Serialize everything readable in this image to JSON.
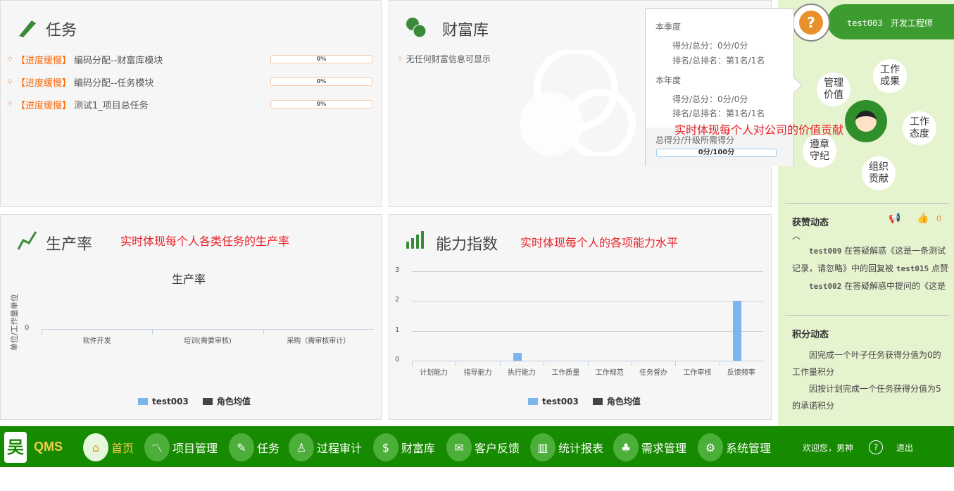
{
  "tasks": {
    "title": "任务",
    "items": [
      {
        "status": "【进度缓慢】",
        "name": "编码分配--财富库模块",
        "progress": "0%"
      },
      {
        "status": "【进度缓慢】",
        "name": "编码分配--任务模块",
        "progress": "0%"
      },
      {
        "status": "【进度缓慢】",
        "name": "测试1_项目总任务",
        "progress": "0%"
      }
    ]
  },
  "wealth": {
    "title": "财富库",
    "empty": "无任何财富信息可显示"
  },
  "productivity": {
    "title": "生产率",
    "annotation": "实时体现每个人各类任务的生产率"
  },
  "ability": {
    "title": "能力指数",
    "annotation": "实时体现每个人的各项能力水平"
  },
  "chart_data": [
    {
      "type": "bar",
      "title": "生产率",
      "ylabel": "单位/工作量单位",
      "categories": [
        "软件开发",
        "培训(需要审核)",
        "采购（需审核审计）"
      ],
      "yticks": [
        "0"
      ],
      "series": [
        {
          "name": "test003",
          "color": "#7cb5ec",
          "values": [
            0,
            0,
            0
          ]
        },
        {
          "name": "角色均值",
          "color": "#434348",
          "values": [
            0,
            0,
            0
          ]
        }
      ]
    },
    {
      "type": "bar",
      "title": "",
      "ylim": [
        0,
        3
      ],
      "yticks": [
        "0",
        "1",
        "2",
        "3"
      ],
      "categories": [
        "计划能力",
        "指导能力",
        "执行能力",
        "工作质量",
        "工作规范",
        "任务督办",
        "工作审核",
        "反馈频率"
      ],
      "series": [
        {
          "name": "test003",
          "color": "#7cb5ec",
          "values": [
            0,
            0,
            0.25,
            0,
            0,
            0,
            0,
            2
          ]
        },
        {
          "name": "角色均值",
          "color": "#434348",
          "values": [
            0,
            0,
            0,
            0,
            0,
            0,
            0,
            0
          ]
        }
      ]
    }
  ],
  "popup": {
    "quarter": "本季度",
    "q_score": "得分/总分：0分/0分",
    "q_rank": "排名/总排名：第1名/1名",
    "year": "本年度",
    "y_score": "得分/总分：0分/0分",
    "y_rank": "排名/总排名：第1名/1名",
    "annotation": "实时体现每个人对公司的价值贡献",
    "total_label": "总得分/升级所需得分",
    "total_value": "0分/100分",
    "total_fraction": 0
  },
  "user": {
    "name": "test003",
    "role": "开发工程师"
  },
  "bubbles": [
    "管理\n价值",
    "工作\n成果",
    "工作\n态度",
    "遵章\n守纪",
    "组织\n贡献"
  ],
  "likes": {
    "title": "获赞动态",
    "count": "0",
    "items": [
      {
        "user": "test009",
        "text": " 在答疑解惑《这是一条测试记录，请忽略》中的回复被 ",
        "user2": "test015",
        "text2": " 点赞"
      },
      {
        "user": "test002",
        "text": " 在答疑解惑中提问的《这是",
        "user2": "",
        "text2": ""
      }
    ]
  },
  "points": {
    "title": "积分动态",
    "items": [
      "因完成一个叶子任务获得分值为0的工作量积分",
      "因按计划完成一个任务获得分值为5的承诺积分"
    ]
  },
  "nav": {
    "logo": "QMS",
    "items": [
      "首页",
      "项目管理",
      "任务",
      "过程审计",
      "财富库",
      "客户反馈",
      "统计报表",
      "需求管理",
      "系统管理"
    ],
    "welcome": "欢迎您，男神",
    "logout": "退出"
  }
}
